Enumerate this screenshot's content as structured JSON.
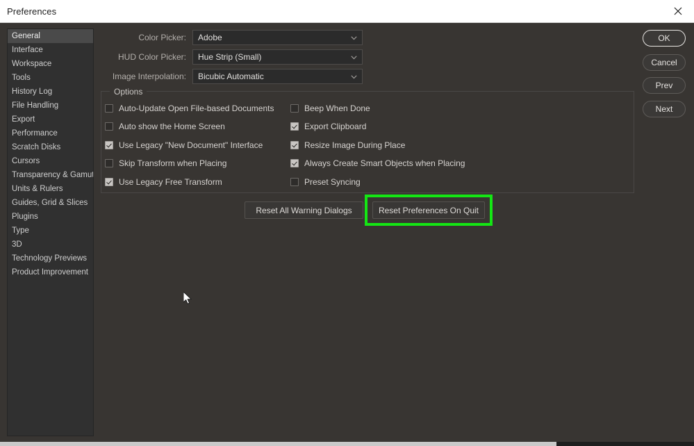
{
  "window": {
    "title": "Preferences",
    "close_icon": "close-icon"
  },
  "sidebar": {
    "items": [
      {
        "label": "General",
        "selected": true
      },
      {
        "label": "Interface",
        "selected": false
      },
      {
        "label": "Workspace",
        "selected": false
      },
      {
        "label": "Tools",
        "selected": false
      },
      {
        "label": "History Log",
        "selected": false
      },
      {
        "label": "File Handling",
        "selected": false
      },
      {
        "label": "Export",
        "selected": false
      },
      {
        "label": "Performance",
        "selected": false
      },
      {
        "label": "Scratch Disks",
        "selected": false
      },
      {
        "label": "Cursors",
        "selected": false
      },
      {
        "label": "Transparency & Gamut",
        "selected": false
      },
      {
        "label": "Units & Rulers",
        "selected": false
      },
      {
        "label": "Guides, Grid & Slices",
        "selected": false
      },
      {
        "label": "Plugins",
        "selected": false
      },
      {
        "label": "Type",
        "selected": false
      },
      {
        "label": "3D",
        "selected": false
      },
      {
        "label": "Technology Previews",
        "selected": false
      },
      {
        "label": "Product Improvement",
        "selected": false
      }
    ]
  },
  "form": {
    "fields": [
      {
        "label": "Color Picker:",
        "value": "Adobe",
        "icon": "chevron-down-icon"
      },
      {
        "label": "HUD Color Picker:",
        "value": "Hue Strip (Small)",
        "icon": "chevron-down-icon"
      },
      {
        "label": "Image Interpolation:",
        "value": "Bicubic Automatic",
        "icon": "chevron-down-icon"
      }
    ]
  },
  "options": {
    "legend": "Options",
    "left_column": [
      {
        "label": "Auto-Update Open File-based Documents",
        "checked": false
      },
      {
        "label": "Auto show the Home Screen",
        "checked": false
      },
      {
        "label": "Use Legacy \"New Document\" Interface",
        "checked": true
      },
      {
        "label": "Skip Transform when Placing",
        "checked": false
      },
      {
        "label": "Use Legacy Free Transform",
        "checked": true
      }
    ],
    "right_column": [
      {
        "label": "Beep When Done",
        "checked": false
      },
      {
        "label": "Export Clipboard",
        "checked": true
      },
      {
        "label": "Resize Image During Place",
        "checked": true
      },
      {
        "label": "Always Create Smart Objects when Placing",
        "checked": true
      },
      {
        "label": "Preset Syncing",
        "checked": false
      }
    ]
  },
  "reset_buttons": [
    {
      "label": "Reset All Warning Dialogs",
      "highlighted": false
    },
    {
      "label": "Reset Preferences On Quit",
      "highlighted": true
    }
  ],
  "action_buttons": [
    {
      "label": "OK",
      "primary": true
    },
    {
      "label": "Cancel",
      "primary": false
    },
    {
      "label": "Prev",
      "primary": false
    },
    {
      "label": "Next",
      "primary": false
    }
  ],
  "highlight": {
    "color": "#14e614"
  },
  "cursor": {
    "icon": "mouse-pointer-icon"
  }
}
